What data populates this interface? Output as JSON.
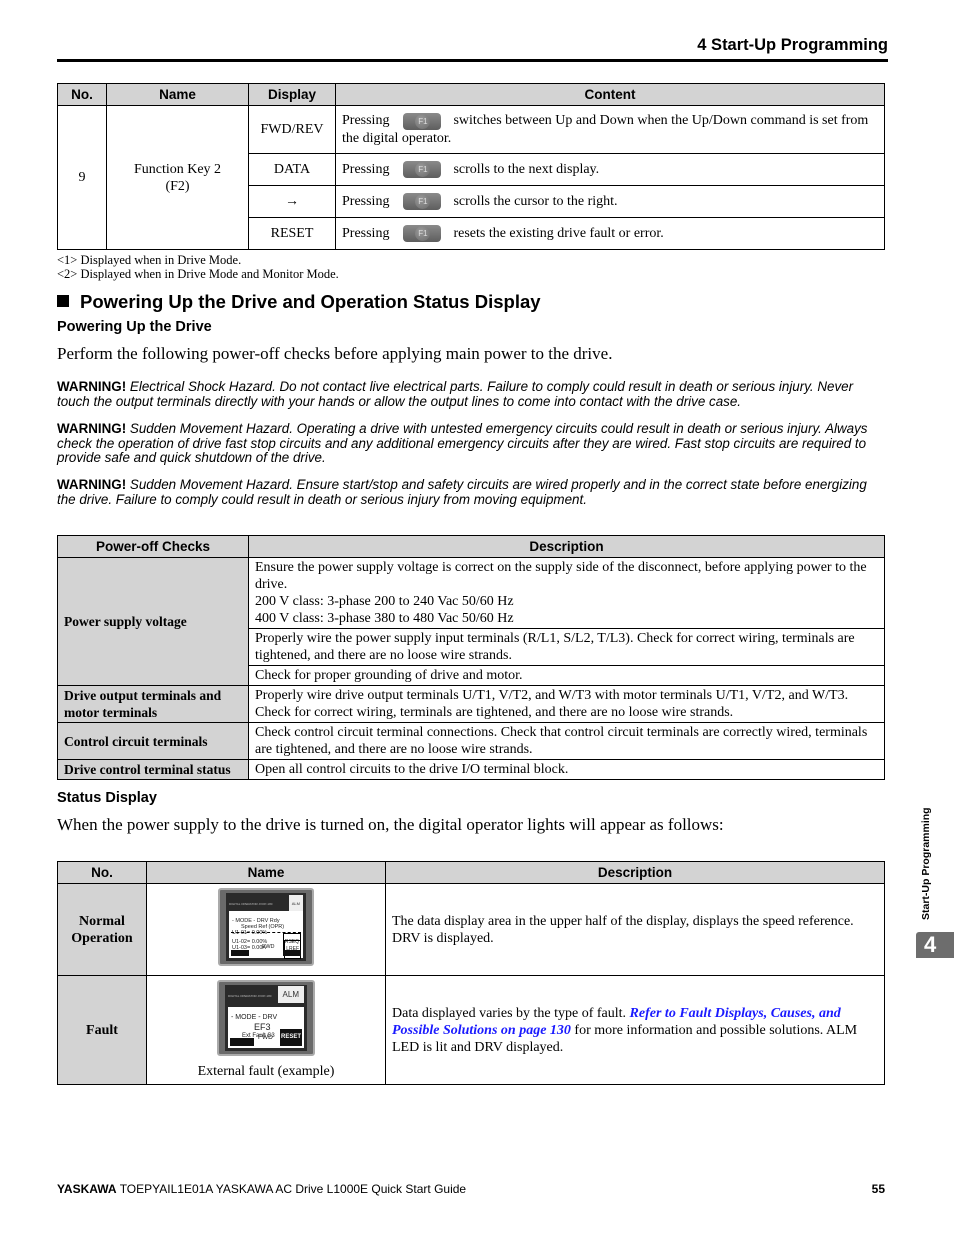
{
  "header": {
    "chapter_title": "4  Start-Up Programming"
  },
  "function_key_table": {
    "columns": [
      "No.",
      "Name",
      "Display",
      "Content"
    ],
    "no": "9",
    "name_line1": "Function Key 2",
    "name_line2": "(F2)",
    "key_label": "F1",
    "rows": [
      {
        "display": "FWD/REV",
        "pre": "Pressing",
        "post": "switches between Up and Down when the Up/Down command is set from",
        "post2": "the digital operator."
      },
      {
        "display": "DATA",
        "pre": "Pressing",
        "post": "scrolls to the next display."
      },
      {
        "display": "→",
        "pre": "Pressing",
        "post": "scrolls the cursor to the right."
      },
      {
        "display": "RESET",
        "pre": "Pressing",
        "post": "resets the existing drive fault or error."
      }
    ]
  },
  "footnotes": [
    "<1> Displayed when in Drive Mode.",
    "<2> Displayed when in Drive Mode and Monitor Mode."
  ],
  "section": {
    "title": "Powering Up the Drive and Operation Status Display",
    "subheading1": "Powering Up the Drive",
    "intro": "Perform the following power-off checks before applying main power to the drive."
  },
  "warnings": [
    {
      "label": "WARNING!",
      "text": "Electrical Shock Hazard. Do not contact live electrical parts. Failure to comply could result in death or serious injury. Never touch the output terminals directly with your hands or allow the output lines to come into contact with the drive case."
    },
    {
      "label": "WARNING!",
      "text": "Sudden Movement Hazard. Operating a drive with untested emergency circuits could result in death or serious injury. Always check the operation of drive fast stop circuits and any additional emergency circuits after they are wired. Fast stop circuits are required to provide safe and quick shutdown of the drive."
    },
    {
      "label": "WARNING!",
      "text": "Sudden Movement Hazard. Ensure start/stop and safety circuits are wired properly and in the correct state before energizing the drive. Failure to comply could result in death or serious injury from moving equipment."
    }
  ],
  "power_off_table": {
    "columns": [
      "Power-off Checks",
      "Description"
    ],
    "power_supply": {
      "label": "Power supply voltage",
      "desc1_line1": "Ensure the power supply voltage is correct on the supply side of the disconnect, before applying power to the drive.",
      "desc1_line2": "200 V class: 3-phase 200 to 240 Vac 50/60 Hz",
      "desc1_line3": "400 V class: 3-phase 380 to 480 Vac 50/60 Hz",
      "desc2": "Properly wire the power supply input terminals (R/L1, S/L2, T/L3). Check for correct wiring, terminals are tightened, and there are no loose wire strands.",
      "desc3": "Check for proper grounding of drive and motor."
    },
    "rows": [
      {
        "label": "Drive output terminals and motor terminals",
        "desc": "Properly wire drive output terminals U/T1, V/T2, and W/T3 with motor terminals U/T1, V/T2, and W/T3. Check for correct wiring, terminals are tightened, and there are no loose wire strands."
      },
      {
        "label": "Control circuit terminals",
        "desc": "Check control circuit terminal connections. Check that control circuit terminals are correctly wired, terminals are tightened, and there are no loose wire strands."
      },
      {
        "label": "Drive control terminal status",
        "desc": "Open all control circuits to the drive I/O terminal block."
      }
    ]
  },
  "status_display": {
    "subheading": "Status Display",
    "intro": "When the power supply to the drive is turned on, the digital operator lights will appear as follows:",
    "columns": [
      "No.",
      "Name",
      "Description"
    ],
    "normal": {
      "label": "Normal Operation",
      "description": "The data display area in the upper half of the display, displays the speed reference. DRV is displayed.",
      "screen": {
        "brand": "DIGITAL OPERATOR JVOP-180",
        "alm": "ALM",
        "line1": "- MODE -      DRV    Rdy",
        "line2": "Speed Ref (OPR)",
        "line3": "U1-01=  0.00%",
        "line4": "U1-02=  0.00%",
        "line5": "U1-03=  0.00A",
        "rseq": "RSEQ",
        "lref": "LREF",
        "fwd": "FWD"
      }
    },
    "fault": {
      "label": "Fault",
      "desc_pre": "Data displayed varies by the type of fault. ",
      "desc_link": "Refer to Fault Displays, Causes, and Possible Solutions on page 130",
      "desc_post": " for more information and possible solutions. ALM LED is lit and DRV displayed.",
      "caption": "External fault (example)",
      "screen": {
        "brand": "DIGITAL OPERATOR JVOP-180",
        "alm": "ALM",
        "line1": "- MODE -    DRV",
        "code": "EF3",
        "detail": "Ext  Fault  S3",
        "fwd": "FWD",
        "reset": "RESET"
      }
    }
  },
  "side_tab": {
    "label": "Start-Up Programming",
    "number": "4"
  },
  "footer": {
    "brand": "YASKAWA",
    "doc": " TOEPYAIL1E01A YASKAWA AC Drive L1000E Quick Start Guide",
    "page": "55"
  }
}
